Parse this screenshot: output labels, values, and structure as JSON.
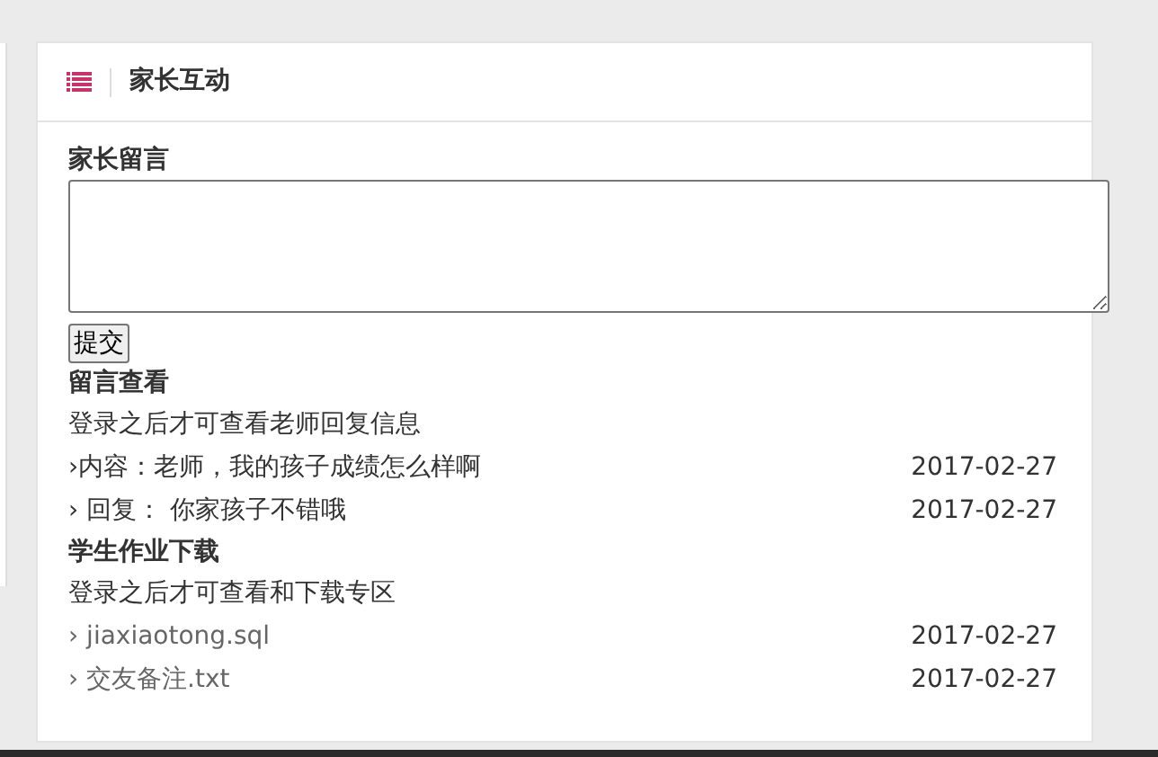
{
  "panel": {
    "title": "家长互动"
  },
  "message_form": {
    "label": "家长留言",
    "submit": "提交"
  },
  "messages": {
    "heading": "留言查看",
    "notice": "登录之后才可查看老师回复信息",
    "items": [
      {
        "text": "›内容：老师，我的孩子成绩怎么样啊",
        "date": "2017-02-27"
      },
      {
        "text": "› 回复： 你家孩子不错哦",
        "date": "2017-02-27"
      }
    ]
  },
  "downloads": {
    "heading": "学生作业下载",
    "notice": "登录之后才可查看和下载专区",
    "items": [
      {
        "text": "› jiaxiaotong.sql",
        "date": "2017-02-27"
      },
      {
        "text": "› 交友备注.txt",
        "date": "2017-02-27"
      }
    ]
  }
}
